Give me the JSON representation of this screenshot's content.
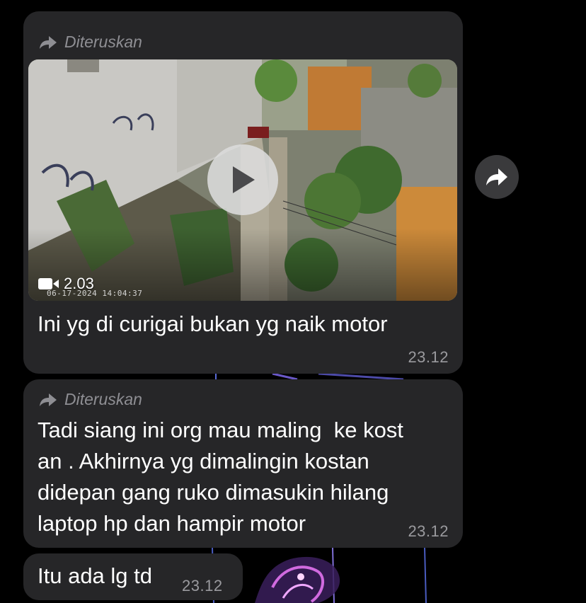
{
  "messages": [
    {
      "forward_label": "Diteruskan",
      "video": {
        "duration": "2.03",
        "camera_timestamp": "06-17-2024 14:04:37"
      },
      "text": "Ini yg di curigai bukan yg naik motor",
      "time": "23.12"
    },
    {
      "forward_label": "Diteruskan",
      "text_lines": [
        "Tadi siang ini org mau maling  ke kost",
        "an . Akhirnya yg dimalingin kostan",
        "didepan gang ruko dimasukin hilang",
        "laptop hp dan hampir motor"
      ],
      "time": "23.12"
    },
    {
      "text": "Itu ada lg td",
      "time": "23.12"
    }
  ],
  "icons": {
    "forward": "forward-arrow-icon",
    "play": "play-icon",
    "video_camera": "video-camera-icon",
    "share": "share-icon"
  },
  "colors": {
    "background": "#000000",
    "bubble": "#262628",
    "meta_text": "#8e8e93"
  }
}
